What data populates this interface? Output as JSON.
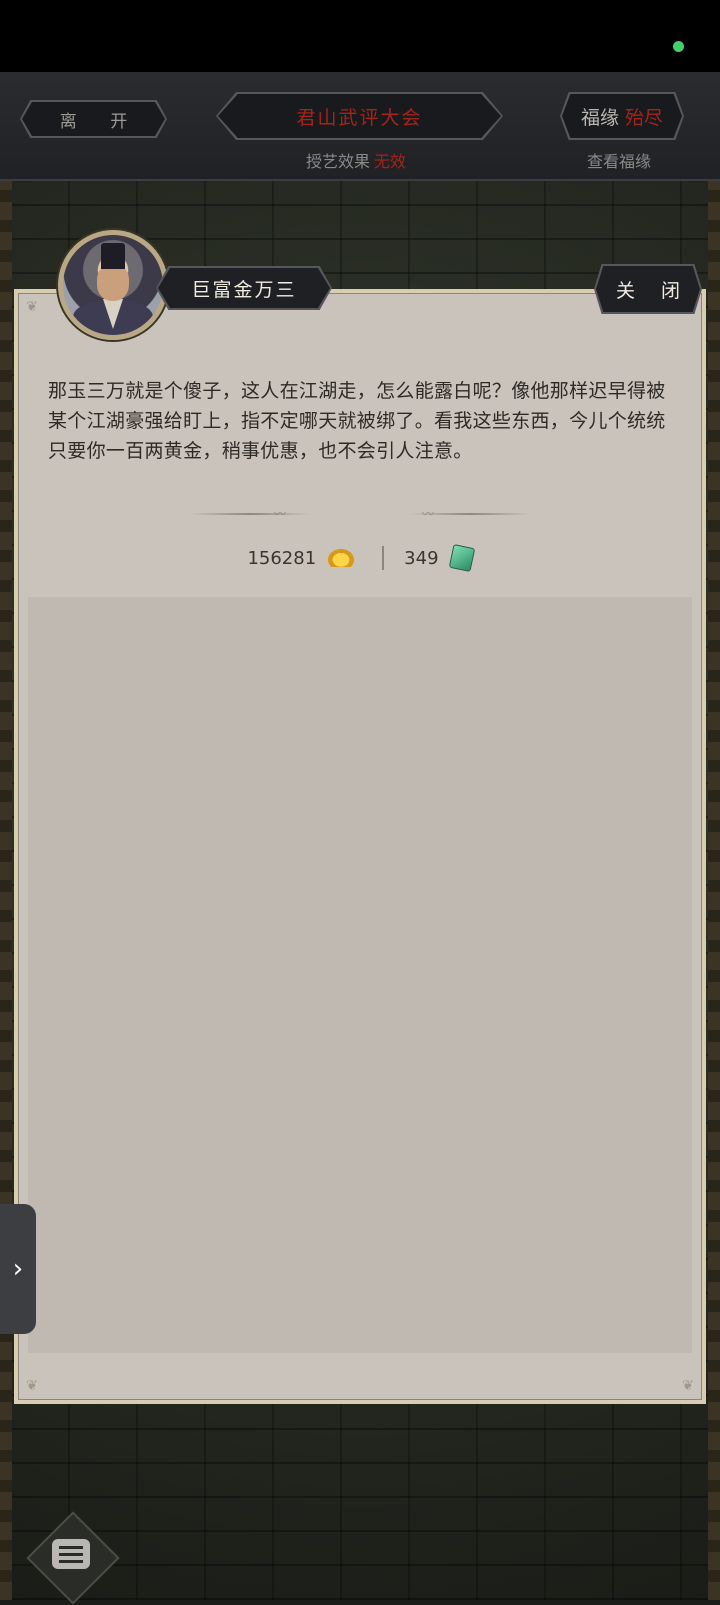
{
  "header": {
    "leave_label": "离 开",
    "event_title": "君山武评大会",
    "skill_effect_label": "授艺效果",
    "skill_effect_value": "无效",
    "fortune_label": "福缘",
    "fortune_value": "殆尽",
    "view_fortune_label": "查看福缘"
  },
  "npc": {
    "name": "巨富金万三",
    "close_label": "关 闭"
  },
  "dialog": {
    "text": "那玉三万就是个傻子，这人在江湖走，怎么能露白呢？像他那样迟早得被某个江湖豪强给盯上，指不定哪天就被绑了。看我这些东西，今儿个统统只要你一百两黄金，稍事优惠，也不会引人注意。"
  },
  "currency": {
    "gold_amount": "156281",
    "gold_icon": "gold-ingot-icon",
    "jade_amount": "349",
    "jade_icon": "jade-token-icon"
  },
  "side_handle": {
    "icon": "chevron-right-icon",
    "glyph": "›"
  },
  "chat": {
    "icon": "chat-bubble-icon"
  },
  "colors": {
    "accent_red": "#a32419",
    "panel_bg": "#c9c3bc",
    "status_green": "#3fd26b"
  }
}
